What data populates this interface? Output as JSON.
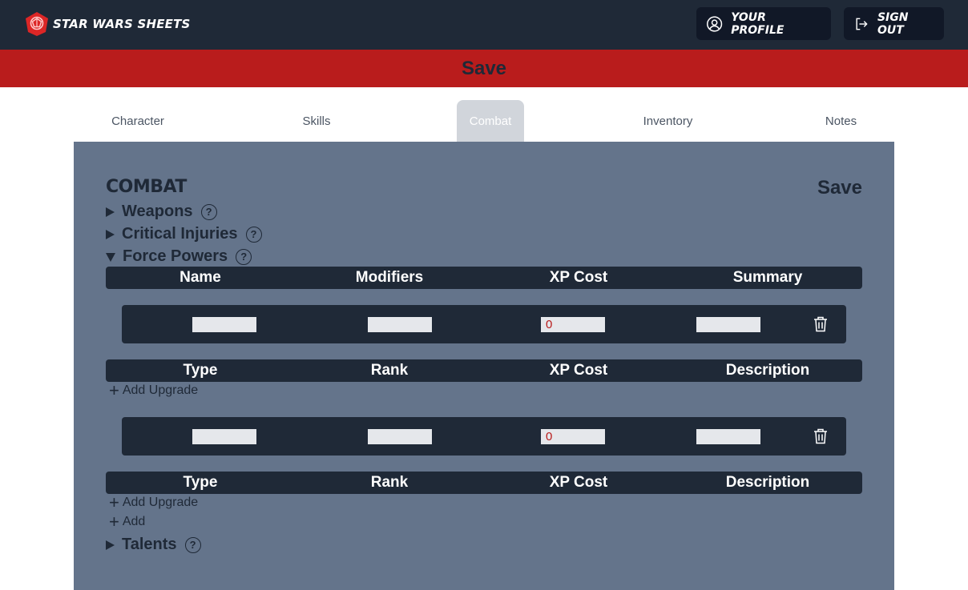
{
  "brand": {
    "name": "Star Wars Sheets",
    "logo_icon": "rebel-shield-logo"
  },
  "nav": {
    "profile_label": "Your Profile",
    "signout_label": "Sign Out"
  },
  "banner": {
    "save_label": "Save"
  },
  "tabs": [
    {
      "label": "Character",
      "active": false
    },
    {
      "label": "Skills",
      "active": false
    },
    {
      "label": "Combat",
      "active": true
    },
    {
      "label": "Inventory",
      "active": false
    },
    {
      "label": "Notes",
      "active": false
    }
  ],
  "panel": {
    "title": "Combat",
    "save_label": "Save",
    "sections": {
      "weapons": {
        "label": "Weapons",
        "expanded": false
      },
      "critical_injuries": {
        "label": "Critical Injuries",
        "expanded": false
      },
      "force_powers": {
        "label": "Force Powers",
        "expanded": true
      },
      "talents": {
        "label": "Talents",
        "expanded": false
      }
    },
    "help_glyph": "?"
  },
  "force_powers": {
    "columns": [
      "Name",
      "Modifiers",
      "XP Cost",
      "Summary"
    ],
    "upgrade_columns": [
      "Type",
      "Rank",
      "XP Cost",
      "Description"
    ],
    "powers": [
      {
        "name": "",
        "modifiers": "",
        "xp_cost": "0",
        "summary": "",
        "add_upgrade_label": "Add Upgrade"
      },
      {
        "name": "",
        "modifiers": "",
        "xp_cost": "0",
        "summary": "",
        "add_upgrade_label": "Add Upgrade"
      }
    ],
    "add_label": "Add"
  },
  "colors": {
    "nav_bg": "#1f2937",
    "banner": "#b91c1c",
    "panel": "#64748b",
    "accent_text": "#b91c1c"
  }
}
